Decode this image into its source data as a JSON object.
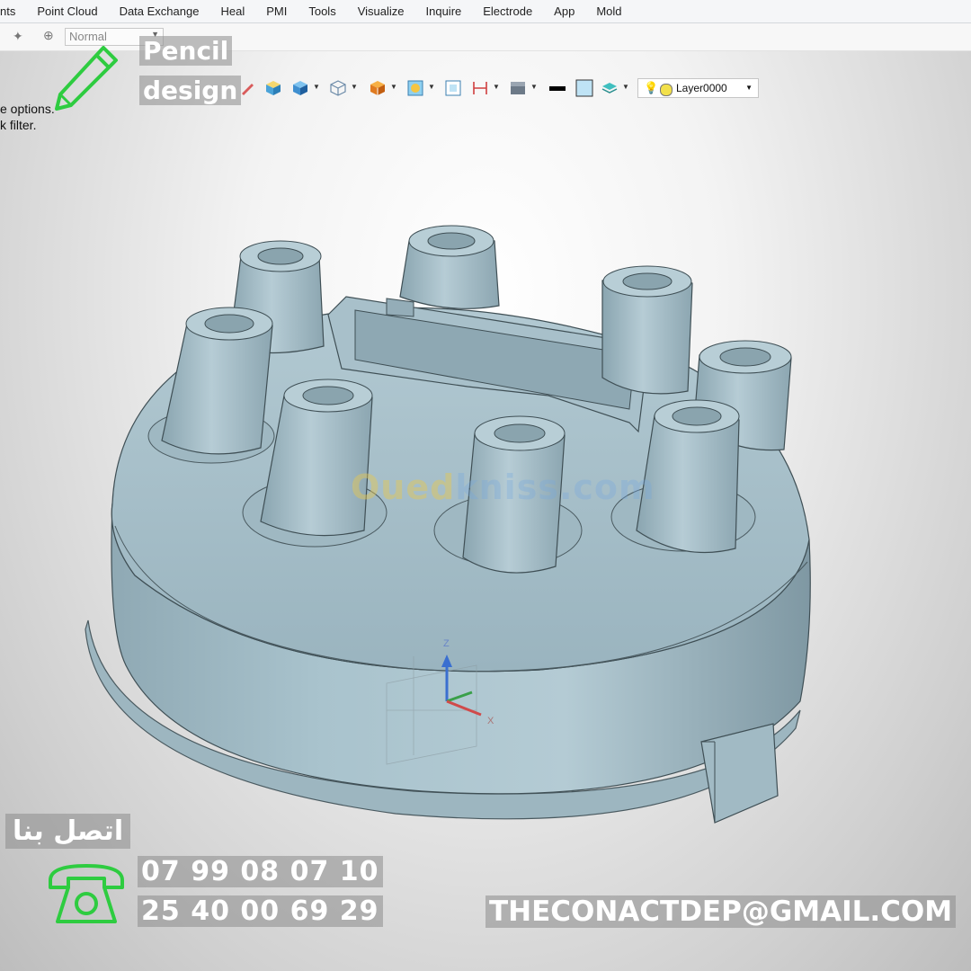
{
  "menu": {
    "items": [
      "nts",
      "Point Cloud",
      "Data Exchange",
      "Heal",
      "PMI",
      "Tools",
      "Visualize",
      "Inquire",
      "Electrode",
      "App",
      "Mold"
    ]
  },
  "toolbar": {
    "mode_value": "Normal",
    "layer_value": "Layer0000"
  },
  "prompt": {
    "line1": "e options.",
    "line2": "k filter."
  },
  "brand": {
    "line1": "Pencil",
    "line2": "design"
  },
  "watermark": {
    "part1": "Oued",
    "part2": "kniss",
    "part3": ".com"
  },
  "axes": {
    "z": "Z",
    "x": "X"
  },
  "contact": {
    "title": "اتصل بنا",
    "phone1": "07 99 08 07 10",
    "phone2": "25 40 00 69 29",
    "email": "THECONACTDEP@GMAIL.COM"
  },
  "colors": {
    "model": "#a3bcc6",
    "accent_green": "#2ecc40",
    "overlay_bg": "#8c8c8c"
  },
  "icons": [
    "pencil-icon",
    "telephone-icon",
    "layer-bulb-icon"
  ]
}
